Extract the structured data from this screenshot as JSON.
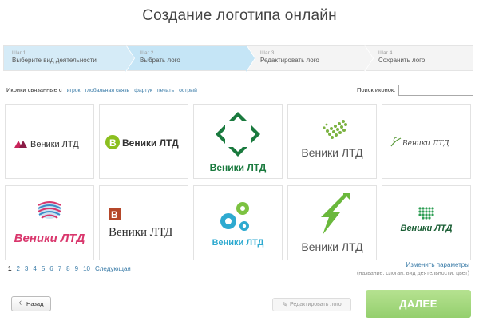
{
  "page": {
    "title": "Создание логотипа онлайн"
  },
  "steps": [
    {
      "num": "Шаг 1",
      "label": "Выберите вид деятельности"
    },
    {
      "num": "Шаг 2",
      "label": "Выбрать лого"
    },
    {
      "num": "Шаг 3",
      "label": "Редактировать лого"
    },
    {
      "num": "Шаг 4",
      "label": "Сохранить лого"
    }
  ],
  "filter": {
    "label": "Иконки связанные с",
    "tags": [
      "игрок",
      "глобальная связь",
      "фартук",
      "печать",
      "острый"
    ]
  },
  "search": {
    "label": "Поиск иконок:",
    "value": "",
    "placeholder": ""
  },
  "logos": [
    {
      "text": "Веники ЛТД",
      "color": "#333333",
      "accent": "#c8245a"
    },
    {
      "text": "Веники ЛТД",
      "color": "#333333",
      "accent": "#8bbf1f"
    },
    {
      "text": "Веники ЛТД",
      "color": "#1a7a3e",
      "accent": "#1a7a3e"
    },
    {
      "text": "Веники ЛТД",
      "color": "#555555",
      "accent": "#7cb342"
    },
    {
      "text": "Веники ЛТД",
      "color": "#444444",
      "accent": "#5a9a3a"
    },
    {
      "text": "Веники ЛТД",
      "color": "#d9366c",
      "accent": "#3a8cc8"
    },
    {
      "text": "Веники ЛТД",
      "color": "#333333",
      "accent": "#b5472a"
    },
    {
      "text": "Веники ЛТД",
      "color": "#2eaad0",
      "accent": "#7cc241"
    },
    {
      "text": "Веники ЛТД",
      "color": "#555555",
      "accent": "#6ab83c"
    },
    {
      "text": "Веники ЛТД",
      "color": "#1a5e34",
      "accent": "#2e9e54"
    }
  ],
  "pagination": {
    "pages": [
      "1",
      "2",
      "3",
      "4",
      "5",
      "6",
      "7",
      "8",
      "9",
      "10"
    ],
    "current": "1",
    "next_label": "Следующая"
  },
  "params": {
    "link": "Изменить параметры",
    "hint": "(название, слоган, вид деятельности, цвет)"
  },
  "buttons": {
    "back": "Назад",
    "edit": "Редактировать лого",
    "next": "ДАЛЕЕ"
  }
}
